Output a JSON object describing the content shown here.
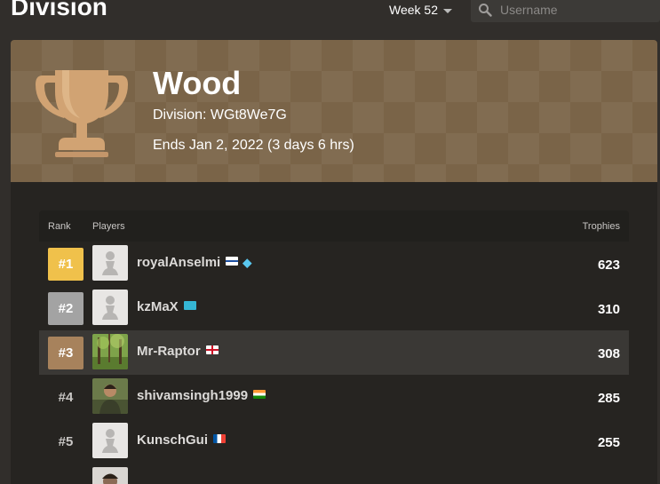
{
  "header": {
    "title": "Division",
    "week_label": "Week 52",
    "search_placeholder": "Username"
  },
  "banner": {
    "league_name": "Wood",
    "division": "Division: WGt8We7G",
    "ends": "Ends Jan 2, 2022 (3 days 6 hrs)",
    "trophy_color": "#d1a373"
  },
  "table": {
    "headers": {
      "rank": "Rank",
      "players": "Players",
      "trophies": "Trophies"
    },
    "rows": [
      {
        "rank": "#1",
        "name": "royalAnselmi",
        "trophies": "623",
        "flag": "finland-flag",
        "badge_color": "#f0c14b",
        "avatar": "pawn-placeholder",
        "diamond": true
      },
      {
        "rank": "#2",
        "name": "kzMaX",
        "trophies": "310",
        "flag": "kazakhstan-flag",
        "badge_color": "#a3a3a3",
        "avatar": "pawn-placeholder"
      },
      {
        "rank": "#3",
        "name": "Mr-Raptor",
        "trophies": "308",
        "flag": "england-flag",
        "badge_color": "#a7825c",
        "avatar": "forest-photo",
        "highlight": true
      },
      {
        "rank": "#4",
        "name": "shivamsingh1999",
        "trophies": "285",
        "flag": "india-flag",
        "avatar": "person-photo"
      },
      {
        "rank": "#5",
        "name": "KunschGui",
        "trophies": "255",
        "flag": "france-flag",
        "avatar": "pawn-placeholder"
      }
    ]
  }
}
